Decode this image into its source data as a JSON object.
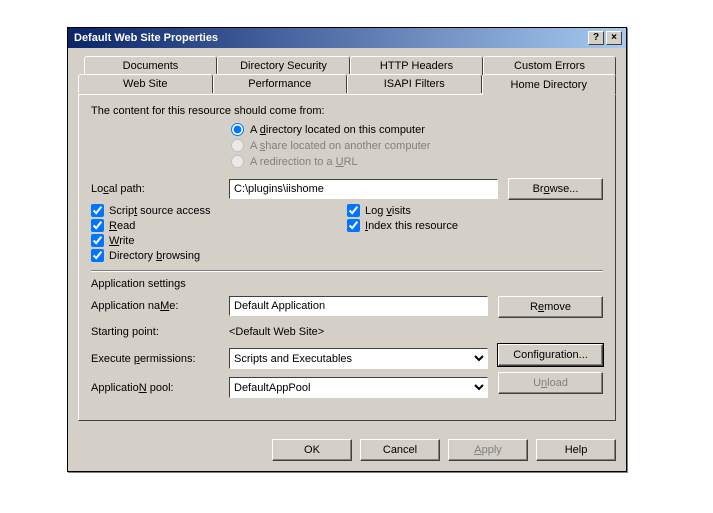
{
  "title": "Default Web Site Properties",
  "tabs": {
    "row1": [
      "Documents",
      "Directory Security",
      "HTTP Headers",
      "Custom Errors"
    ],
    "row2": [
      "Web Site",
      "Performance",
      "ISAPI Filters",
      "Home Directory"
    ]
  },
  "source": {
    "caption": "The content for this resource should come from:",
    "opt_dir": "A directory located on this computer",
    "opt_share": "A share located on another computer",
    "opt_redirect": "A redirection to a URL",
    "u_dir": "d",
    "u_share": "s",
    "u_url": "U"
  },
  "path": {
    "label": "Local path:",
    "u": "c",
    "value": "C:\\plugins\\iishome",
    "browse": "Browse...",
    "browse_u": "o"
  },
  "checks": {
    "script": {
      "label": "Script source access",
      "u": "t",
      "checked": true
    },
    "read": {
      "label": "Read",
      "u": "R",
      "checked": true
    },
    "write": {
      "label": "Write",
      "u": "W",
      "checked": true
    },
    "browse": {
      "label": "Directory browsing",
      "u": "b",
      "checked": true
    },
    "log": {
      "label": "Log visits",
      "u": "v",
      "checked": true
    },
    "index": {
      "label": "Index this resource",
      "u": "I",
      "checked": true
    }
  },
  "app": {
    "section": "Application settings",
    "name_label": "Application name:",
    "name_u": "M",
    "name_value": "Default Application",
    "start_label": "Starting point:",
    "start_value": "<Default Web Site>",
    "exec_label": "Execute permissions:",
    "exec_u": "p",
    "exec_value": "Scripts and Executables",
    "pool_label": "Application pool:",
    "pool_u": "N",
    "pool_value": "DefaultAppPool",
    "remove": "Remove",
    "remove_u": "e",
    "config": "Configuration...",
    "config_u": "g",
    "unload": "Unload",
    "unload_u": "n"
  },
  "footer": {
    "ok": "OK",
    "cancel": "Cancel",
    "apply": "Apply",
    "apply_u": "A",
    "help": "Help"
  }
}
